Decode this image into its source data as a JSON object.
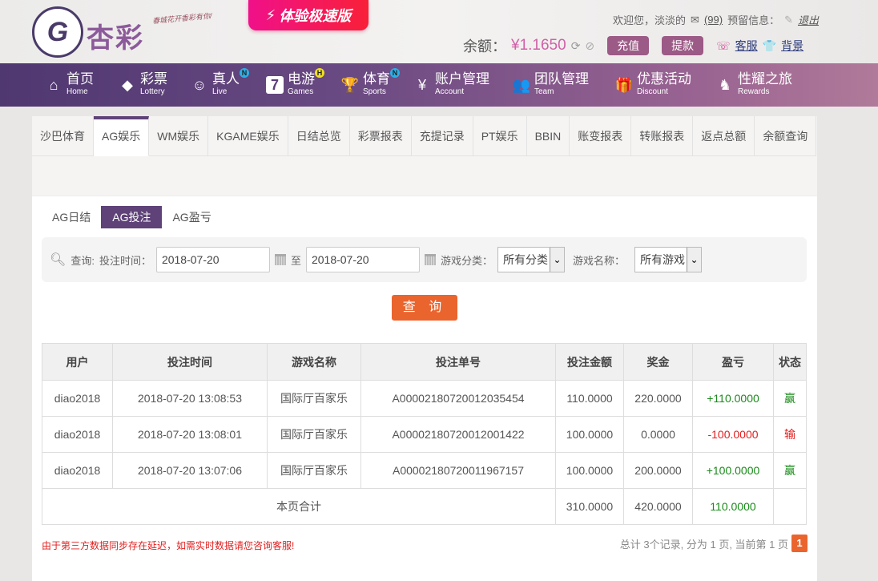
{
  "header": {
    "logo_mark": "G",
    "logo_text": "杏彩",
    "tagline": "春城花开香彩有你/",
    "promo": "体验极速版",
    "welcome": "欢迎您，淡淡的",
    "messages": "(99)",
    "reserve_info": "预留信息：",
    "logout": "退出",
    "balance_label": "余额：",
    "balance": "¥1.1650",
    "deposit": "充值",
    "withdraw": "提款",
    "service": "客服",
    "background": "背景"
  },
  "nav": [
    {
      "cn": "首页",
      "en": "Home"
    },
    {
      "cn": "彩票",
      "en": "Lottery"
    },
    {
      "cn": "真人",
      "en": "Live",
      "badge": "N"
    },
    {
      "cn": "电游",
      "en": "Games",
      "badge": "H"
    },
    {
      "cn": "体育",
      "en": "Sports",
      "badge": "N"
    },
    {
      "cn": "账户管理",
      "en": "Account"
    },
    {
      "cn": "团队管理",
      "en": "Team"
    },
    {
      "cn": "优惠活动",
      "en": "Discount"
    },
    {
      "cn": "性耀之旅",
      "en": "Rewards"
    }
  ],
  "tabs": [
    "沙巴体育",
    "AG娱乐",
    "WM娱乐",
    "KGAME娱乐",
    "日结总览",
    "彩票报表",
    "充提记录",
    "PT娱乐",
    "BBIN",
    "账变报表",
    "转账报表",
    "返点总额",
    "余额查询"
  ],
  "subtabs": [
    "AG日结",
    "AG投注",
    "AG盈亏"
  ],
  "search": {
    "query_label": "查询:",
    "time_label": "投注时间：",
    "from": "2018-07-20",
    "to_label": "至",
    "to": "2018-07-20",
    "category_label": "游戏分类：",
    "category": "所有分类",
    "game_label": "游戏名称：",
    "game": "所有游戏",
    "button": "查 询"
  },
  "table": {
    "headers": [
      "用户",
      "投注时间",
      "游戏名称",
      "投注单号",
      "投注金额",
      "奖金",
      "盈亏",
      "状态"
    ],
    "rows": [
      [
        "diao2018",
        "2018-07-20 13:08:53",
        "国际厅百家乐",
        "A00002180720012035454",
        "110.0000",
        "220.0000",
        "+110.0000",
        "赢"
      ],
      [
        "diao2018",
        "2018-07-20 13:08:01",
        "国际厅百家乐",
        "A00002180720012001422",
        "100.0000",
        "0.0000",
        "-100.0000",
        "输"
      ],
      [
        "diao2018",
        "2018-07-20 13:07:06",
        "国际厅百家乐",
        "A00002180720011967157",
        "100.0000",
        "200.0000",
        "+100.0000",
        "赢"
      ]
    ],
    "total": {
      "label": "本页合计",
      "bet": "310.0000",
      "prize": "420.0000",
      "profit": "110.0000"
    }
  },
  "footer": {
    "note": "由于第三方数据同步存在延迟，如需实时数据请您咨询客服!",
    "summary": "总计 3个记录, 分为 1 页, 当前第 1 页",
    "page": "1"
  },
  "colors": {
    "purple": "#5e4278",
    "orange": "#ea642e",
    "win": "#1a8a1a",
    "lose": "#e02020"
  }
}
